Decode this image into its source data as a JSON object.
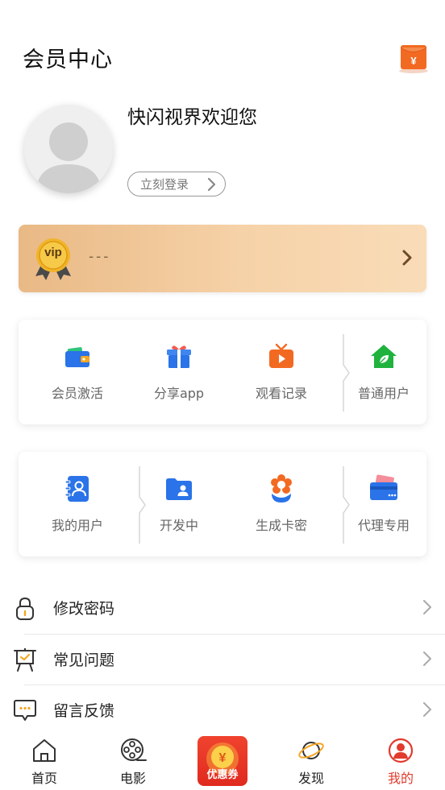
{
  "header": {
    "title": "会员中心",
    "wallet_icon": "red-envelope-icon"
  },
  "profile": {
    "welcome": "快闪视界欢迎您",
    "login_label": "立刻登录"
  },
  "vip": {
    "badge_text": "vip",
    "status_text": "---"
  },
  "grid1": [
    {
      "label": "会员激活",
      "icon": "wallet-icon"
    },
    {
      "label": "分享app",
      "icon": "gift-icon"
    },
    {
      "label": "观看记录",
      "icon": "tv-play-icon"
    },
    {
      "label": "普通用户",
      "icon": "house-leaf-icon"
    }
  ],
  "grid2": [
    {
      "label": "我的用户",
      "icon": "contacts-book-icon"
    },
    {
      "label": "开发中",
      "icon": "user-folder-icon"
    },
    {
      "label": "生成卡密",
      "icon": "flower-icon"
    },
    {
      "label": "代理专用",
      "icon": "card-icon"
    }
  ],
  "menu": [
    {
      "label": "修改密码",
      "icon": "lock-icon"
    },
    {
      "label": "常见问题",
      "icon": "presentation-board-icon"
    },
    {
      "label": "留言反馈",
      "icon": "chat-bubble-icon"
    }
  ],
  "tabbar": {
    "home": "首页",
    "movie": "电影",
    "coupon": "优惠券",
    "discover": "发现",
    "mine": "我的"
  },
  "colors": {
    "accent": "#e23a2e",
    "vip_gold": "#e9b985",
    "orange": "#f26a21"
  }
}
